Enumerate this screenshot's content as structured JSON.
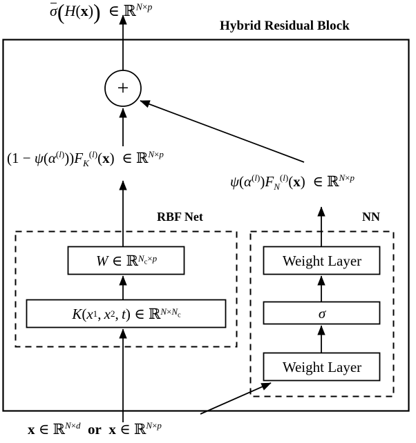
{
  "figure": {
    "title": "Hybrid Residual Block",
    "output_label": "σ̄(H(x)) ∈ ℝ^{N×p}",
    "input_label": "x ∈ ℝ^{N×d} or x ∈ ℝ^{N×p}",
    "left_branch_label": "(1 − ψ(α^{(l)}))F_K^{(l)}(x) ∈ ℝ^{N×p}",
    "right_branch_label": "ψ(α^{(l)})F_N^{(l)}(x) ∈ ℝ^{N×p}",
    "sum_node": "+"
  },
  "groups": {
    "rbf": {
      "title": "RBF Net",
      "style": "dashed"
    },
    "nn": {
      "title": "NN",
      "style": "dashed"
    }
  },
  "boxes": {
    "weight_matrix": "W ∈ ℝ^{N_c×p}",
    "kernel": "K(x₁, x₂, t) ∈ ℝ^{N×N_c}",
    "weight_layer_top": "Weight Layer",
    "activation": "σ",
    "weight_layer_bottom": "Weight Layer"
  },
  "colors": {
    "stroke": "#000000",
    "background": "#ffffff",
    "text": "#000000"
  }
}
